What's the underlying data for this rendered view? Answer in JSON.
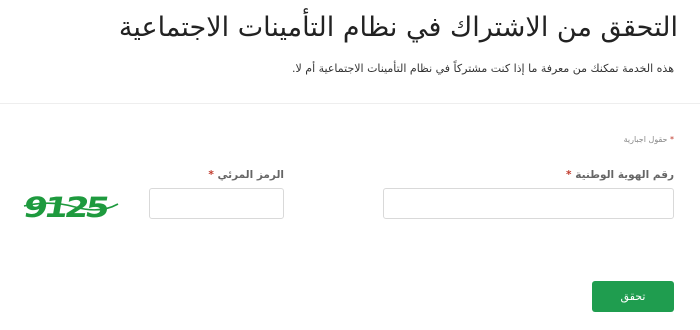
{
  "header": {
    "title": "التحقق من الاشتراك في نظام التأمينات الاجتماعية",
    "description": "هذه الخدمة تمكنك من معرفة ما إذا كنت مشتركاً في نظام التأمينات الاجتماعية أم لا."
  },
  "form": {
    "required_note": "حقول اجبارية",
    "required_marker": "*",
    "national_id": {
      "label": "رقم الهوية الوطنية",
      "value": "",
      "placeholder": ""
    },
    "captcha": {
      "label": "الرمز المرئي",
      "value": "",
      "placeholder": "",
      "image_text": "9125",
      "image_color": "#1e9a3e"
    },
    "submit_label": "تحقق"
  },
  "colors": {
    "accent": "#1f9d4f",
    "required": "#c0392b"
  }
}
